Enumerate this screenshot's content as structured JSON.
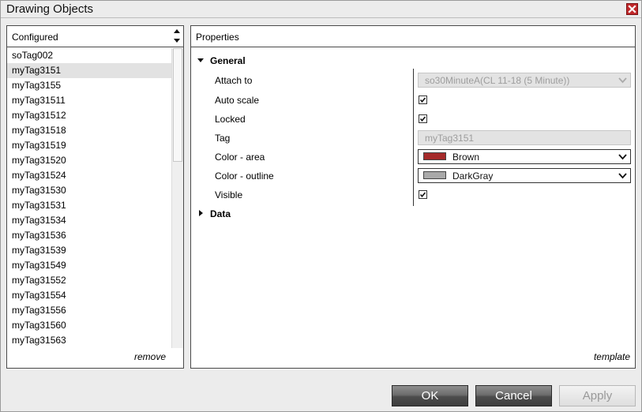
{
  "window": {
    "title": "Drawing Objects"
  },
  "configured": {
    "header": "Configured",
    "items": [
      "soTag002",
      "myTag3151",
      "myTag3155",
      "myTag31511",
      "myTag31512",
      "myTag31518",
      "myTag31519",
      "myTag31520",
      "myTag31524",
      "myTag31530",
      "myTag31531",
      "myTag31534",
      "myTag31536",
      "myTag31539",
      "myTag31549",
      "myTag31552",
      "myTag31554",
      "myTag31556",
      "myTag31560",
      "myTag31563"
    ],
    "selected_index": 1,
    "remove_label": "remove"
  },
  "properties": {
    "header": "Properties",
    "groups": {
      "general": "General",
      "data": "Data"
    },
    "labels": {
      "attach_to": "Attach to",
      "auto_scale": "Auto scale",
      "locked": "Locked",
      "tag": "Tag",
      "color_area": "Color - area",
      "color_outline": "Color - outline",
      "visible": "Visible"
    },
    "values": {
      "attach_to": "so30MinuteA(CL 11-18 (5 Minute))",
      "auto_scale": true,
      "locked": true,
      "tag": "myTag3151",
      "color_area": "Brown",
      "color_outline": "DarkGray",
      "visible": true
    },
    "swatch_colors": {
      "color_area": "#a52a2a",
      "color_outline": "#a9a9a9"
    },
    "template_label": "template"
  },
  "buttons": {
    "ok": "OK",
    "cancel": "Cancel",
    "apply": "Apply"
  },
  "icons": {
    "close": "close-icon",
    "sort": "sort-arrows-icon",
    "expand": "triangle-icon",
    "dropdown": "chevron-down-icon",
    "check": "checkmark-icon"
  }
}
